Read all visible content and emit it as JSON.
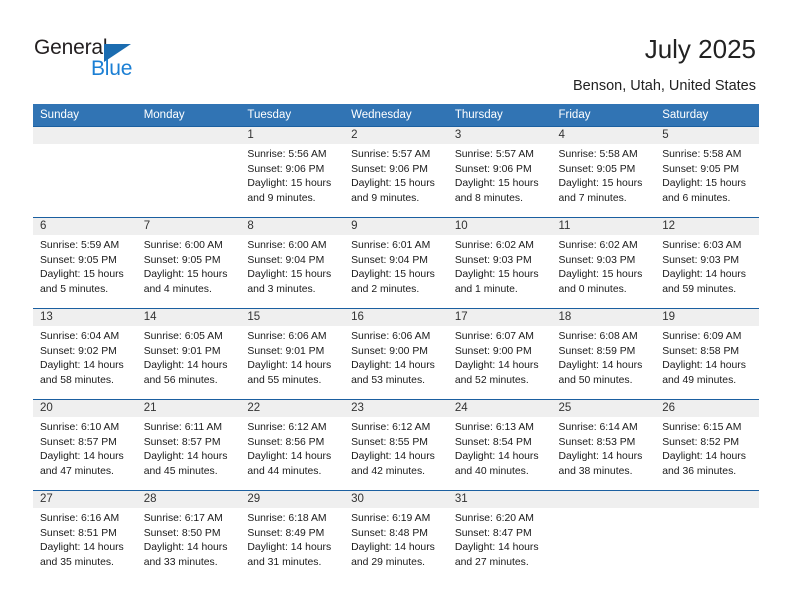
{
  "brand": {
    "name_part1": "General",
    "name_part2": "Blue",
    "triangle_color": "#1b6cb0",
    "blue_color": "#1b7fd4"
  },
  "header": {
    "title": "July 2025",
    "subtitle": "Benson, Utah, United States"
  },
  "theme": {
    "header_bg": "#3174b4",
    "row_border": "#1b5fa0",
    "daynum_bg": "#efefef"
  },
  "weekday_headers": [
    "Sunday",
    "Monday",
    "Tuesday",
    "Wednesday",
    "Thursday",
    "Friday",
    "Saturday"
  ],
  "weeks": [
    [
      {
        "day": "",
        "lines": []
      },
      {
        "day": "",
        "lines": []
      },
      {
        "day": "1",
        "lines": [
          "Sunrise: 5:56 AM",
          "Sunset: 9:06 PM",
          "Daylight: 15 hours",
          "and 9 minutes."
        ]
      },
      {
        "day": "2",
        "lines": [
          "Sunrise: 5:57 AM",
          "Sunset: 9:06 PM",
          "Daylight: 15 hours",
          "and 9 minutes."
        ]
      },
      {
        "day": "3",
        "lines": [
          "Sunrise: 5:57 AM",
          "Sunset: 9:06 PM",
          "Daylight: 15 hours",
          "and 8 minutes."
        ]
      },
      {
        "day": "4",
        "lines": [
          "Sunrise: 5:58 AM",
          "Sunset: 9:05 PM",
          "Daylight: 15 hours",
          "and 7 minutes."
        ]
      },
      {
        "day": "5",
        "lines": [
          "Sunrise: 5:58 AM",
          "Sunset: 9:05 PM",
          "Daylight: 15 hours",
          "and 6 minutes."
        ]
      }
    ],
    [
      {
        "day": "6",
        "lines": [
          "Sunrise: 5:59 AM",
          "Sunset: 9:05 PM",
          "Daylight: 15 hours",
          "and 5 minutes."
        ]
      },
      {
        "day": "7",
        "lines": [
          "Sunrise: 6:00 AM",
          "Sunset: 9:05 PM",
          "Daylight: 15 hours",
          "and 4 minutes."
        ]
      },
      {
        "day": "8",
        "lines": [
          "Sunrise: 6:00 AM",
          "Sunset: 9:04 PM",
          "Daylight: 15 hours",
          "and 3 minutes."
        ]
      },
      {
        "day": "9",
        "lines": [
          "Sunrise: 6:01 AM",
          "Sunset: 9:04 PM",
          "Daylight: 15 hours",
          "and 2 minutes."
        ]
      },
      {
        "day": "10",
        "lines": [
          "Sunrise: 6:02 AM",
          "Sunset: 9:03 PM",
          "Daylight: 15 hours",
          "and 1 minute."
        ]
      },
      {
        "day": "11",
        "lines": [
          "Sunrise: 6:02 AM",
          "Sunset: 9:03 PM",
          "Daylight: 15 hours",
          "and 0 minutes."
        ]
      },
      {
        "day": "12",
        "lines": [
          "Sunrise: 6:03 AM",
          "Sunset: 9:03 PM",
          "Daylight: 14 hours",
          "and 59 minutes."
        ]
      }
    ],
    [
      {
        "day": "13",
        "lines": [
          "Sunrise: 6:04 AM",
          "Sunset: 9:02 PM",
          "Daylight: 14 hours",
          "and 58 minutes."
        ]
      },
      {
        "day": "14",
        "lines": [
          "Sunrise: 6:05 AM",
          "Sunset: 9:01 PM",
          "Daylight: 14 hours",
          "and 56 minutes."
        ]
      },
      {
        "day": "15",
        "lines": [
          "Sunrise: 6:06 AM",
          "Sunset: 9:01 PM",
          "Daylight: 14 hours",
          "and 55 minutes."
        ]
      },
      {
        "day": "16",
        "lines": [
          "Sunrise: 6:06 AM",
          "Sunset: 9:00 PM",
          "Daylight: 14 hours",
          "and 53 minutes."
        ]
      },
      {
        "day": "17",
        "lines": [
          "Sunrise: 6:07 AM",
          "Sunset: 9:00 PM",
          "Daylight: 14 hours",
          "and 52 minutes."
        ]
      },
      {
        "day": "18",
        "lines": [
          "Sunrise: 6:08 AM",
          "Sunset: 8:59 PM",
          "Daylight: 14 hours",
          "and 50 minutes."
        ]
      },
      {
        "day": "19",
        "lines": [
          "Sunrise: 6:09 AM",
          "Sunset: 8:58 PM",
          "Daylight: 14 hours",
          "and 49 minutes."
        ]
      }
    ],
    [
      {
        "day": "20",
        "lines": [
          "Sunrise: 6:10 AM",
          "Sunset: 8:57 PM",
          "Daylight: 14 hours",
          "and 47 minutes."
        ]
      },
      {
        "day": "21",
        "lines": [
          "Sunrise: 6:11 AM",
          "Sunset: 8:57 PM",
          "Daylight: 14 hours",
          "and 45 minutes."
        ]
      },
      {
        "day": "22",
        "lines": [
          "Sunrise: 6:12 AM",
          "Sunset: 8:56 PM",
          "Daylight: 14 hours",
          "and 44 minutes."
        ]
      },
      {
        "day": "23",
        "lines": [
          "Sunrise: 6:12 AM",
          "Sunset: 8:55 PM",
          "Daylight: 14 hours",
          "and 42 minutes."
        ]
      },
      {
        "day": "24",
        "lines": [
          "Sunrise: 6:13 AM",
          "Sunset: 8:54 PM",
          "Daylight: 14 hours",
          "and 40 minutes."
        ]
      },
      {
        "day": "25",
        "lines": [
          "Sunrise: 6:14 AM",
          "Sunset: 8:53 PM",
          "Daylight: 14 hours",
          "and 38 minutes."
        ]
      },
      {
        "day": "26",
        "lines": [
          "Sunrise: 6:15 AM",
          "Sunset: 8:52 PM",
          "Daylight: 14 hours",
          "and 36 minutes."
        ]
      }
    ],
    [
      {
        "day": "27",
        "lines": [
          "Sunrise: 6:16 AM",
          "Sunset: 8:51 PM",
          "Daylight: 14 hours",
          "and 35 minutes."
        ]
      },
      {
        "day": "28",
        "lines": [
          "Sunrise: 6:17 AM",
          "Sunset: 8:50 PM",
          "Daylight: 14 hours",
          "and 33 minutes."
        ]
      },
      {
        "day": "29",
        "lines": [
          "Sunrise: 6:18 AM",
          "Sunset: 8:49 PM",
          "Daylight: 14 hours",
          "and 31 minutes."
        ]
      },
      {
        "day": "30",
        "lines": [
          "Sunrise: 6:19 AM",
          "Sunset: 8:48 PM",
          "Daylight: 14 hours",
          "and 29 minutes."
        ]
      },
      {
        "day": "31",
        "lines": [
          "Sunrise: 6:20 AM",
          "Sunset: 8:47 PM",
          "Daylight: 14 hours",
          "and 27 minutes."
        ]
      },
      {
        "day": "",
        "lines": []
      },
      {
        "day": "",
        "lines": []
      }
    ]
  ]
}
